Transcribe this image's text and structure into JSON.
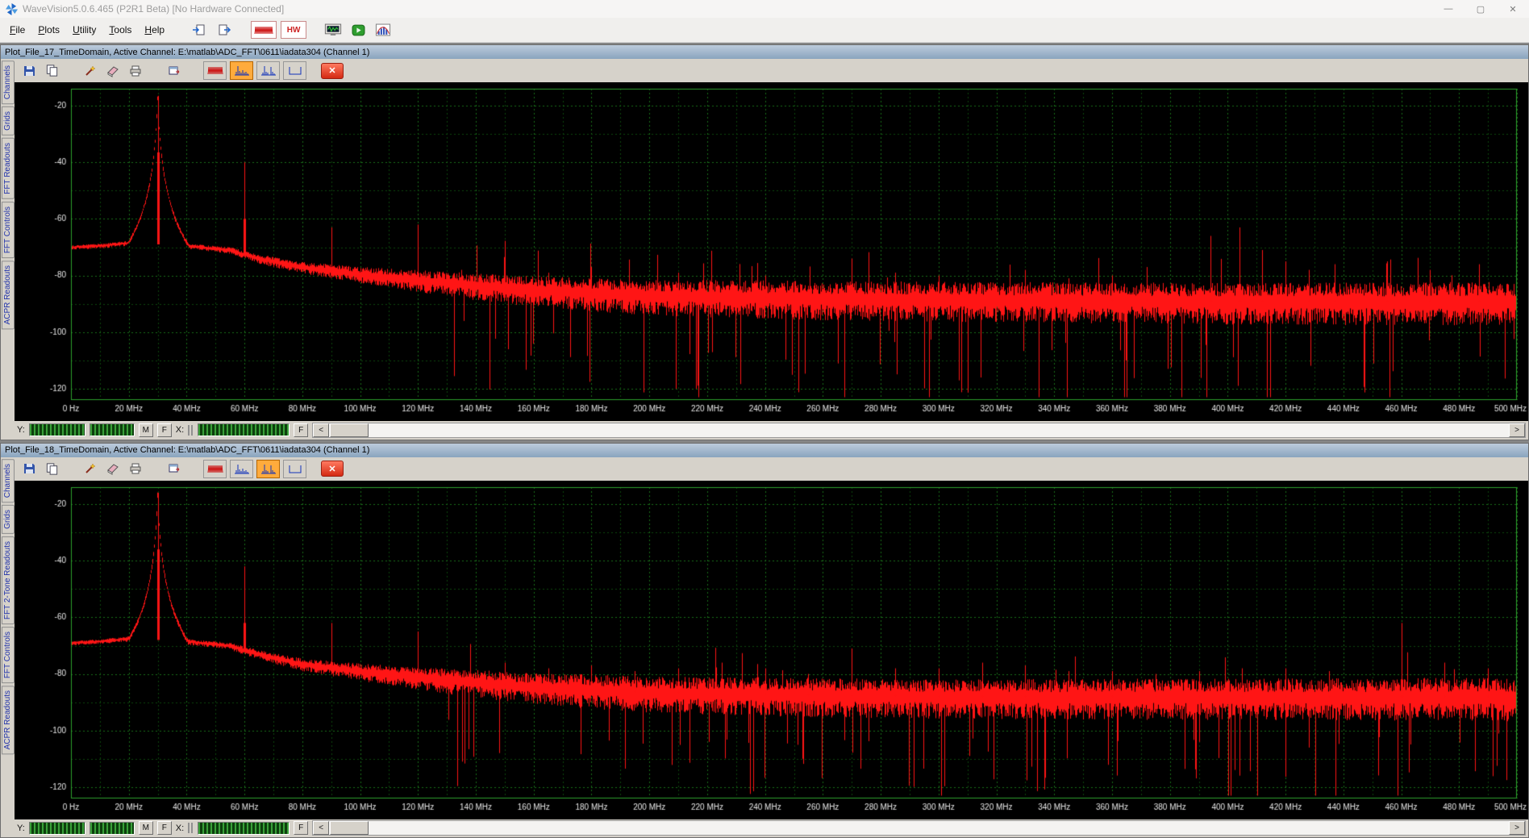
{
  "window": {
    "title": "WaveVision5.0.6.465 (P2R1 Beta)  [No Hardware Connected]",
    "minimize": "—",
    "maximize": "▢",
    "close": "✕"
  },
  "menu": {
    "items": [
      "File",
      "Plots",
      "Utility",
      "Tools",
      "Help"
    ]
  },
  "main_toolbar": {
    "hw_label": "HW"
  },
  "plot_controls": {
    "y_label": "Y:",
    "x_label": "X:",
    "m_button": "M",
    "f_button": "F",
    "f2_button": "F",
    "scroll_left": "<",
    "scroll_right": ">",
    "close_button": "✕"
  },
  "plots": [
    {
      "title": "Plot_File_17_TimeDomain,  Active Channel: E:\\matlab\\ADC_FFT\\0611\\iadata304 (Channel 1)",
      "side_tabs": [
        "Channels",
        "Grids",
        "FFT Readouts",
        "FFT Controls",
        "ACPR Readouts"
      ],
      "toolbar": {
        "active_mode": 1
      },
      "chart_data": {
        "type": "line",
        "x_unit": "MHz",
        "x_range": [
          0,
          500
        ],
        "x_tick_step": 20,
        "x_tick_labels": [
          "0 Hz",
          "20 MHz",
          "40 MHz",
          "60 MHz",
          "80 MHz",
          "100 MHz",
          "120 MHz",
          "140 MHz",
          "160 MHz",
          "180 MHz",
          "200 MHz",
          "220 MHz",
          "240 MHz",
          "260 MHz",
          "280 MHz",
          "300 MHz",
          "320 MHz",
          "340 MHz",
          "360 MHz",
          "380 MHz",
          "400 MHz",
          "420 MHz",
          "440 MHz",
          "460 MHz",
          "480 MHz",
          "500 MHz"
        ],
        "y_ticks": [
          -20,
          -40,
          -60,
          -80,
          -100,
          -120
        ],
        "y_tick_labels": [
          "-20",
          "-40",
          "-60",
          "-80",
          "-100",
          "-120"
        ],
        "y_view": [
          -14,
          -124
        ],
        "trace_color": "#ff1515",
        "grid_major": "#1a6e1a",
        "grid_minor": "#0c460c",
        "border_color": "#2da02d",
        "label_color": "#e6e6e6",
        "bg_color": "#000000",
        "fundamental": {
          "freq_mhz": 30,
          "level_db": -16.5
        },
        "spurs": [
          [
            60,
            -40
          ],
          [
            90,
            -63
          ],
          [
            120,
            -62
          ],
          [
            135,
            -78
          ],
          [
            150,
            -75
          ],
          [
            165,
            -79
          ],
          [
            180,
            -77
          ],
          [
            210,
            -79
          ],
          [
            240,
            -80
          ],
          [
            270,
            -74
          ],
          [
            285,
            -79
          ],
          [
            300,
            -80
          ],
          [
            330,
            -78
          ],
          [
            345,
            -81
          ],
          [
            360,
            -80
          ],
          [
            372,
            -77
          ],
          [
            394,
            -66
          ],
          [
            404,
            -63
          ],
          [
            412,
            -71
          ],
          [
            420,
            -75
          ],
          [
            428,
            -78
          ],
          [
            437,
            -76
          ],
          [
            455,
            -75
          ],
          [
            470,
            -78
          ],
          [
            487,
            -76
          ]
        ],
        "noise_floor_db": [
          [
            0,
            -70
          ],
          [
            10,
            -69.5
          ],
          [
            20,
            -68.5
          ],
          [
            40,
            -69.5
          ],
          [
            55,
            -71
          ],
          [
            65,
            -74
          ],
          [
            80,
            -77
          ],
          [
            100,
            -79.5
          ],
          [
            130,
            -82.5
          ],
          [
            160,
            -85
          ],
          [
            200,
            -87
          ],
          [
            260,
            -88
          ],
          [
            320,
            -88.5
          ],
          [
            400,
            -89
          ],
          [
            500,
            -89
          ]
        ],
        "noise_spread_db": [
          [
            0,
            0.7
          ],
          [
            50,
            0.9
          ],
          [
            70,
            1.6
          ],
          [
            90,
            2.2
          ],
          [
            110,
            3.0
          ],
          [
            140,
            4.2
          ],
          [
            180,
            5.2
          ],
          [
            240,
            6.0
          ],
          [
            320,
            6.2
          ],
          [
            420,
            6.5
          ],
          [
            500,
            6.8
          ]
        ]
      }
    },
    {
      "title": "Plot_File_18_TimeDomain,  Active Channel: E:\\matlab\\ADC_FFT\\0611\\iadata304 (Channel 1)",
      "side_tabs": [
        "Channels",
        "Grids",
        "FFT 2-Tone Readouts",
        "FFT Controls",
        "ACPR Readouts"
      ],
      "toolbar": {
        "active_mode": 2
      },
      "chart_data": {
        "type": "line",
        "x_unit": "MHz",
        "x_range": [
          0,
          500
        ],
        "x_tick_step": 20,
        "x_tick_labels": [
          "0 Hz",
          "20 MHz",
          "40 MHz",
          "60 MHz",
          "80 MHz",
          "100 MHz",
          "120 MHz",
          "140 MHz",
          "160 MHz",
          "180 MHz",
          "200 MHz",
          "220 MHz",
          "240 MHz",
          "260 MHz",
          "280 MHz",
          "300 MHz",
          "320 MHz",
          "340 MHz",
          "360 MHz",
          "380 MHz",
          "400 MHz",
          "420 MHz",
          "440 MHz",
          "460 MHz",
          "480 MHz",
          "500 MHz"
        ],
        "y_ticks": [
          -20,
          -40,
          -60,
          -80,
          -100,
          -120
        ],
        "y_tick_labels": [
          "-20",
          "-40",
          "-60",
          "-80",
          "-100",
          "-120"
        ],
        "y_view": [
          -14,
          -124
        ],
        "trace_color": "#ff1515",
        "grid_major": "#1a6e1a",
        "grid_minor": "#0c460c",
        "border_color": "#2da02d",
        "label_color": "#e6e6e6",
        "bg_color": "#000000",
        "fundamental": {
          "freq_mhz": 30,
          "level_db": -16
        },
        "spurs": [
          [
            60,
            -42
          ],
          [
            90,
            -62
          ],
          [
            120,
            -65
          ],
          [
            150,
            -76
          ],
          [
            165,
            -78
          ],
          [
            180,
            -77
          ],
          [
            195,
            -79
          ],
          [
            210,
            -78
          ],
          [
            225,
            -76
          ],
          [
            240,
            -78
          ],
          [
            255,
            -80
          ],
          [
            270,
            -71
          ],
          [
            285,
            -78
          ],
          [
            300,
            -78
          ],
          [
            315,
            -76
          ],
          [
            330,
            -77
          ],
          [
            345,
            -79
          ],
          [
            360,
            -79
          ],
          [
            375,
            -80
          ],
          [
            390,
            -79
          ],
          [
            405,
            -78
          ],
          [
            420,
            -78
          ],
          [
            435,
            -79
          ],
          [
            460,
            -62
          ],
          [
            475,
            -76
          ],
          [
            490,
            -78
          ]
        ],
        "noise_floor_db": [
          [
            0,
            -69
          ],
          [
            10,
            -68.5
          ],
          [
            20,
            -67.5
          ],
          [
            40,
            -68.5
          ],
          [
            55,
            -70
          ],
          [
            65,
            -73
          ],
          [
            80,
            -76.5
          ],
          [
            100,
            -79
          ],
          [
            130,
            -82
          ],
          [
            160,
            -84.5
          ],
          [
            200,
            -86.5
          ],
          [
            260,
            -87.5
          ],
          [
            320,
            -88
          ],
          [
            400,
            -88
          ],
          [
            500,
            -88
          ]
        ],
        "noise_spread_db": [
          [
            0,
            0.7
          ],
          [
            50,
            1.0
          ],
          [
            70,
            1.7
          ],
          [
            90,
            2.3
          ],
          [
            110,
            3.1
          ],
          [
            140,
            4.3
          ],
          [
            180,
            5.3
          ],
          [
            240,
            6.0
          ],
          [
            320,
            6.2
          ],
          [
            420,
            6.4
          ],
          [
            500,
            6.8
          ]
        ]
      }
    }
  ]
}
